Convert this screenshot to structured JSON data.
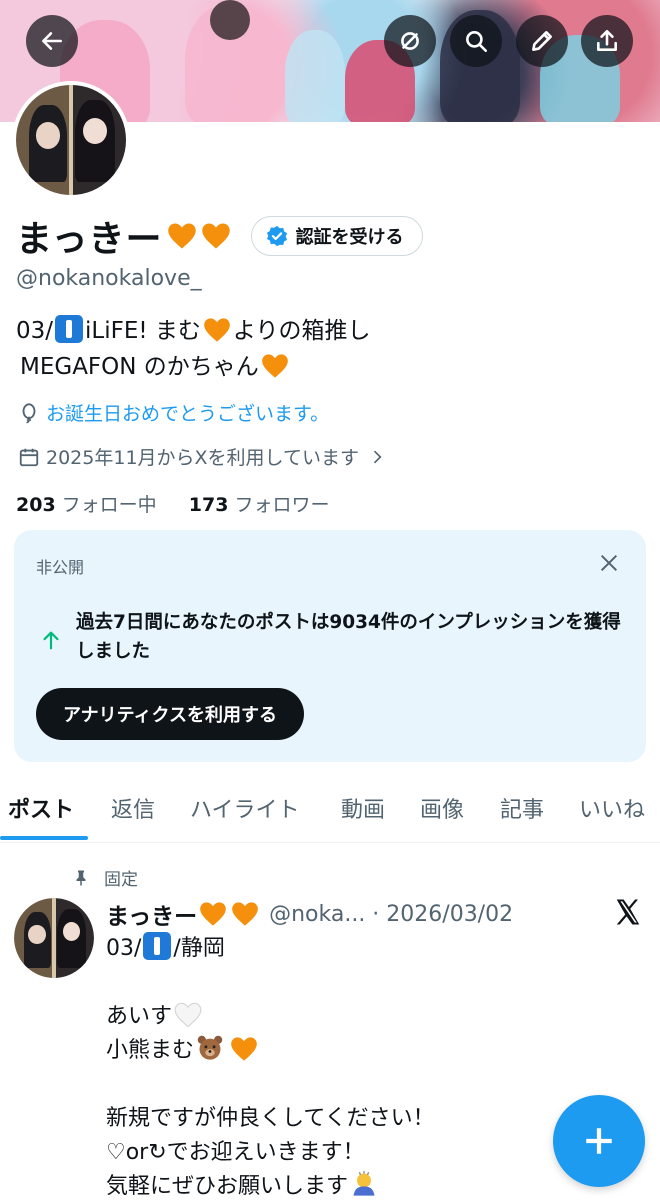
{
  "header": {
    "back_icon": "arrow-left-icon",
    "buttons": [
      "pencil-slash-icon",
      "search-icon",
      "edit-icon",
      "share-icon"
    ]
  },
  "profile": {
    "name": "まっきー",
    "verify_label": "認証を受ける",
    "handle": "@nokanokalove_",
    "bio_line1_prefix": "03/",
    "bio_line1_rest": "iLiFE! まむ",
    "bio_line1_suffix": "よりの箱推し",
    "bio_line2": "MEGAFON のかちゃん",
    "birthday_text": "お誕生日おめでとうございます。",
    "joined_text": "2025年11月からXを利用しています",
    "following_count": "203",
    "following_label": "フォロー中",
    "followers_count": "173",
    "followers_label": "フォロワー"
  },
  "analytics_card": {
    "private_label": "非公開",
    "message": "過去7日間にあなたのポストは9034件のインプレッションを獲得しました",
    "button_label": "アナリティクスを利用する"
  },
  "tabs": [
    {
      "label": "ポスト",
      "active": true
    },
    {
      "label": "返信"
    },
    {
      "label": "ハイライト"
    },
    {
      "label": "動画"
    },
    {
      "label": "画像"
    },
    {
      "label": "記事"
    },
    {
      "label": "いいね"
    }
  ],
  "pinned_post": {
    "pinned_label": "固定",
    "name": "まっきー",
    "meta": "@noka... · 2026/03/02",
    "line1_prefix": "03/",
    "line1_suffix": "/静岡",
    "line2": "あいす",
    "line3": "小熊まむ",
    "line4": "新規ですが仲良くしてください！",
    "line5": "♡or↻でお迎えいきます！",
    "line6": "気軽にぜひお願いします"
  },
  "colors": {
    "accent": "#1d9bf0",
    "text": "#0f1419",
    "muted": "#536471",
    "card_bg": "#e8f5fd",
    "heart": "#f4900c"
  }
}
